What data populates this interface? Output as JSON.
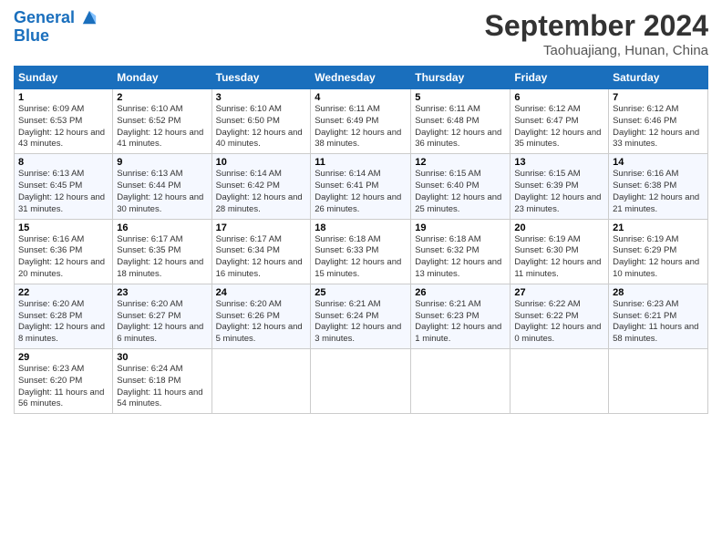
{
  "header": {
    "logo_line1": "General",
    "logo_line2": "Blue",
    "title": "September 2024",
    "subtitle": "Taohuajiang, Hunan, China"
  },
  "calendar": {
    "days_of_week": [
      "Sunday",
      "Monday",
      "Tuesday",
      "Wednesday",
      "Thursday",
      "Friday",
      "Saturday"
    ],
    "weeks": [
      [
        {
          "day": "1",
          "sunrise": "6:09 AM",
          "sunset": "6:53 PM",
          "daylight": "12 hours and 43 minutes."
        },
        {
          "day": "2",
          "sunrise": "6:10 AM",
          "sunset": "6:52 PM",
          "daylight": "12 hours and 41 minutes."
        },
        {
          "day": "3",
          "sunrise": "6:10 AM",
          "sunset": "6:50 PM",
          "daylight": "12 hours and 40 minutes."
        },
        {
          "day": "4",
          "sunrise": "6:11 AM",
          "sunset": "6:49 PM",
          "daylight": "12 hours and 38 minutes."
        },
        {
          "day": "5",
          "sunrise": "6:11 AM",
          "sunset": "6:48 PM",
          "daylight": "12 hours and 36 minutes."
        },
        {
          "day": "6",
          "sunrise": "6:12 AM",
          "sunset": "6:47 PM",
          "daylight": "12 hours and 35 minutes."
        },
        {
          "day": "7",
          "sunrise": "6:12 AM",
          "sunset": "6:46 PM",
          "daylight": "12 hours and 33 minutes."
        }
      ],
      [
        {
          "day": "8",
          "sunrise": "6:13 AM",
          "sunset": "6:45 PM",
          "daylight": "12 hours and 31 minutes."
        },
        {
          "day": "9",
          "sunrise": "6:13 AM",
          "sunset": "6:44 PM",
          "daylight": "12 hours and 30 minutes."
        },
        {
          "day": "10",
          "sunrise": "6:14 AM",
          "sunset": "6:42 PM",
          "daylight": "12 hours and 28 minutes."
        },
        {
          "day": "11",
          "sunrise": "6:14 AM",
          "sunset": "6:41 PM",
          "daylight": "12 hours and 26 minutes."
        },
        {
          "day": "12",
          "sunrise": "6:15 AM",
          "sunset": "6:40 PM",
          "daylight": "12 hours and 25 minutes."
        },
        {
          "day": "13",
          "sunrise": "6:15 AM",
          "sunset": "6:39 PM",
          "daylight": "12 hours and 23 minutes."
        },
        {
          "day": "14",
          "sunrise": "6:16 AM",
          "sunset": "6:38 PM",
          "daylight": "12 hours and 21 minutes."
        }
      ],
      [
        {
          "day": "15",
          "sunrise": "6:16 AM",
          "sunset": "6:36 PM",
          "daylight": "12 hours and 20 minutes."
        },
        {
          "day": "16",
          "sunrise": "6:17 AM",
          "sunset": "6:35 PM",
          "daylight": "12 hours and 18 minutes."
        },
        {
          "day": "17",
          "sunrise": "6:17 AM",
          "sunset": "6:34 PM",
          "daylight": "12 hours and 16 minutes."
        },
        {
          "day": "18",
          "sunrise": "6:18 AM",
          "sunset": "6:33 PM",
          "daylight": "12 hours and 15 minutes."
        },
        {
          "day": "19",
          "sunrise": "6:18 AM",
          "sunset": "6:32 PM",
          "daylight": "12 hours and 13 minutes."
        },
        {
          "day": "20",
          "sunrise": "6:19 AM",
          "sunset": "6:30 PM",
          "daylight": "12 hours and 11 minutes."
        },
        {
          "day": "21",
          "sunrise": "6:19 AM",
          "sunset": "6:29 PM",
          "daylight": "12 hours and 10 minutes."
        }
      ],
      [
        {
          "day": "22",
          "sunrise": "6:20 AM",
          "sunset": "6:28 PM",
          "daylight": "12 hours and 8 minutes."
        },
        {
          "day": "23",
          "sunrise": "6:20 AM",
          "sunset": "6:27 PM",
          "daylight": "12 hours and 6 minutes."
        },
        {
          "day": "24",
          "sunrise": "6:20 AM",
          "sunset": "6:26 PM",
          "daylight": "12 hours and 5 minutes."
        },
        {
          "day": "25",
          "sunrise": "6:21 AM",
          "sunset": "6:24 PM",
          "daylight": "12 hours and 3 minutes."
        },
        {
          "day": "26",
          "sunrise": "6:21 AM",
          "sunset": "6:23 PM",
          "daylight": "12 hours and 1 minute."
        },
        {
          "day": "27",
          "sunrise": "6:22 AM",
          "sunset": "6:22 PM",
          "daylight": "12 hours and 0 minutes."
        },
        {
          "day": "28",
          "sunrise": "6:23 AM",
          "sunset": "6:21 PM",
          "daylight": "11 hours and 58 minutes."
        }
      ],
      [
        {
          "day": "29",
          "sunrise": "6:23 AM",
          "sunset": "6:20 PM",
          "daylight": "11 hours and 56 minutes."
        },
        {
          "day": "30",
          "sunrise": "6:24 AM",
          "sunset": "6:18 PM",
          "daylight": "11 hours and 54 minutes."
        },
        null,
        null,
        null,
        null,
        null
      ]
    ]
  }
}
